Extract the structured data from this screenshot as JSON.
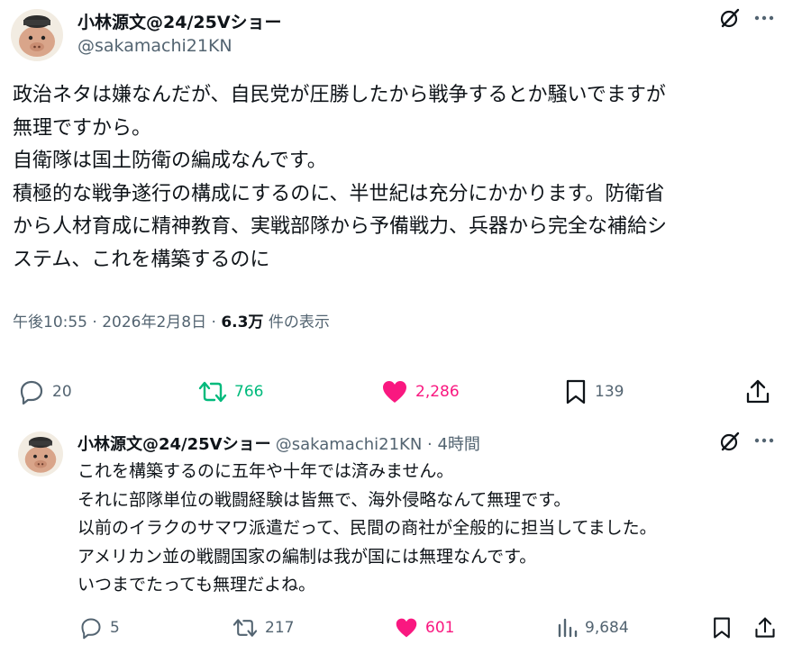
{
  "main_tweet": {
    "author_name": "小林源文@24/25Vショー",
    "author_handle": "@sakamachi21KN",
    "body_lines": [
      "政治ネタは嫌なんだが、自民党が圧勝したから戦争するとか騒いでますが",
      "無理ですから。",
      "自衛隊は国土防衛の編成なんです。",
      "積極的な戦争遂行の構成にするのに、半世紀は充分にかかります。防衛省",
      "から人材育成に精神教育、実戦部隊から予備戦力、兵器から完全な補給シ",
      "ステム、これを構築するのに"
    ],
    "timestamp": "午後10:55 · 2026年2月8日 · ",
    "views": "6.3万",
    "views_suffix": " 件の表示",
    "replies": "20",
    "reposts": "766",
    "likes": "2,286",
    "bookmarks": "139"
  },
  "reply_tweet": {
    "author_name": "小林源文@24/25Vショー",
    "author_handle": "@sakamachi21KN",
    "time": " · 4時間",
    "body_lines": [
      "これを構築するのに五年や十年では済みません。",
      "それに部隊単位の戦闘経験は皆無で、海外侵略なんて無理です。",
      "以前のイラクのサマワ派遣だって、民間の商社が全般的に担当してました。",
      "アメリカン並の戦闘国家の編制は我が国には無理なんです。",
      "いつまでたっても無理だよね。"
    ],
    "replies": "5",
    "reposts": "217",
    "likes": "601",
    "views": "9,684"
  },
  "colors": {
    "text": "#0f1419",
    "secondary": "#536471",
    "repost_green": "#00ba7c",
    "like_pink": "#f91880"
  },
  "icons": [
    "grok-icon",
    "more-icon",
    "reply-icon",
    "repost-icon",
    "like-icon",
    "bookmark-icon",
    "share-icon",
    "views-icon"
  ]
}
